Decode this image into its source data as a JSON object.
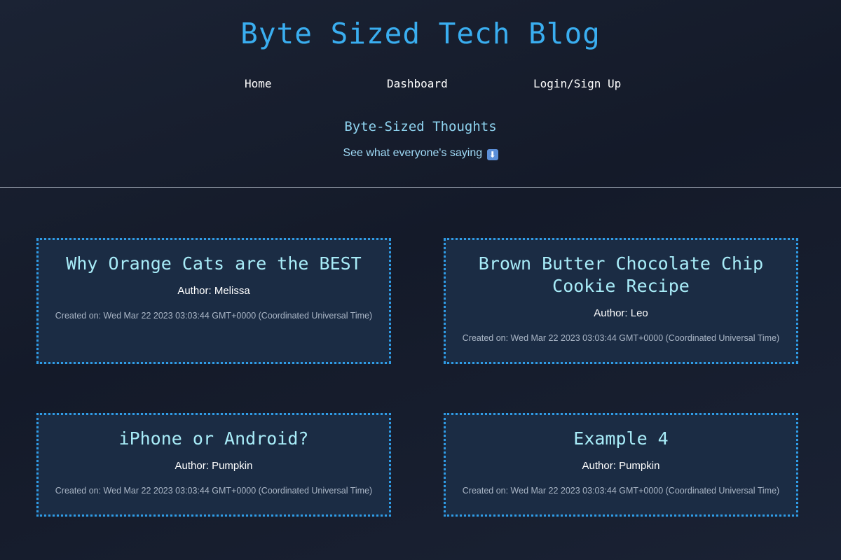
{
  "header": {
    "title": "Byte Sized Tech Blog",
    "nav": {
      "home": "Home",
      "dashboard": "Dashboard",
      "login": "Login/Sign Up"
    },
    "tagline": "Byte-Sized Thoughts",
    "subtagline": "See what everyone's saying",
    "subtagline_icon": "down-arrow-icon",
    "subtagline_icon_glyph": "⬇"
  },
  "posts": [
    {
      "title": "Why Orange Cats are the BEST",
      "author": "Author: Melissa",
      "created": "Created on: Wed Mar 22 2023 03:03:44 GMT+0000 (Coordinated Universal Time)"
    },
    {
      "title": "Brown Butter Chocolate Chip Cookie Recipe",
      "author": "Author: Leo",
      "created": "Created on: Wed Mar 22 2023 03:03:44 GMT+0000 (Coordinated Universal Time)"
    },
    {
      "title": "iPhone or Android?",
      "author": "Author: Pumpkin",
      "created": "Created on: Wed Mar 22 2023 03:03:44 GMT+0000 (Coordinated Universal Time)"
    },
    {
      "title": "Example 4",
      "author": "Author: Pumpkin",
      "created": "Created on: Wed Mar 22 2023 03:03:44 GMT+0000 (Coordinated Universal Time)"
    }
  ],
  "colors": {
    "title": "#3aaef0",
    "post_title": "#a8ecf8",
    "card_border": "#2f9ce6",
    "background": "#171e2e"
  }
}
